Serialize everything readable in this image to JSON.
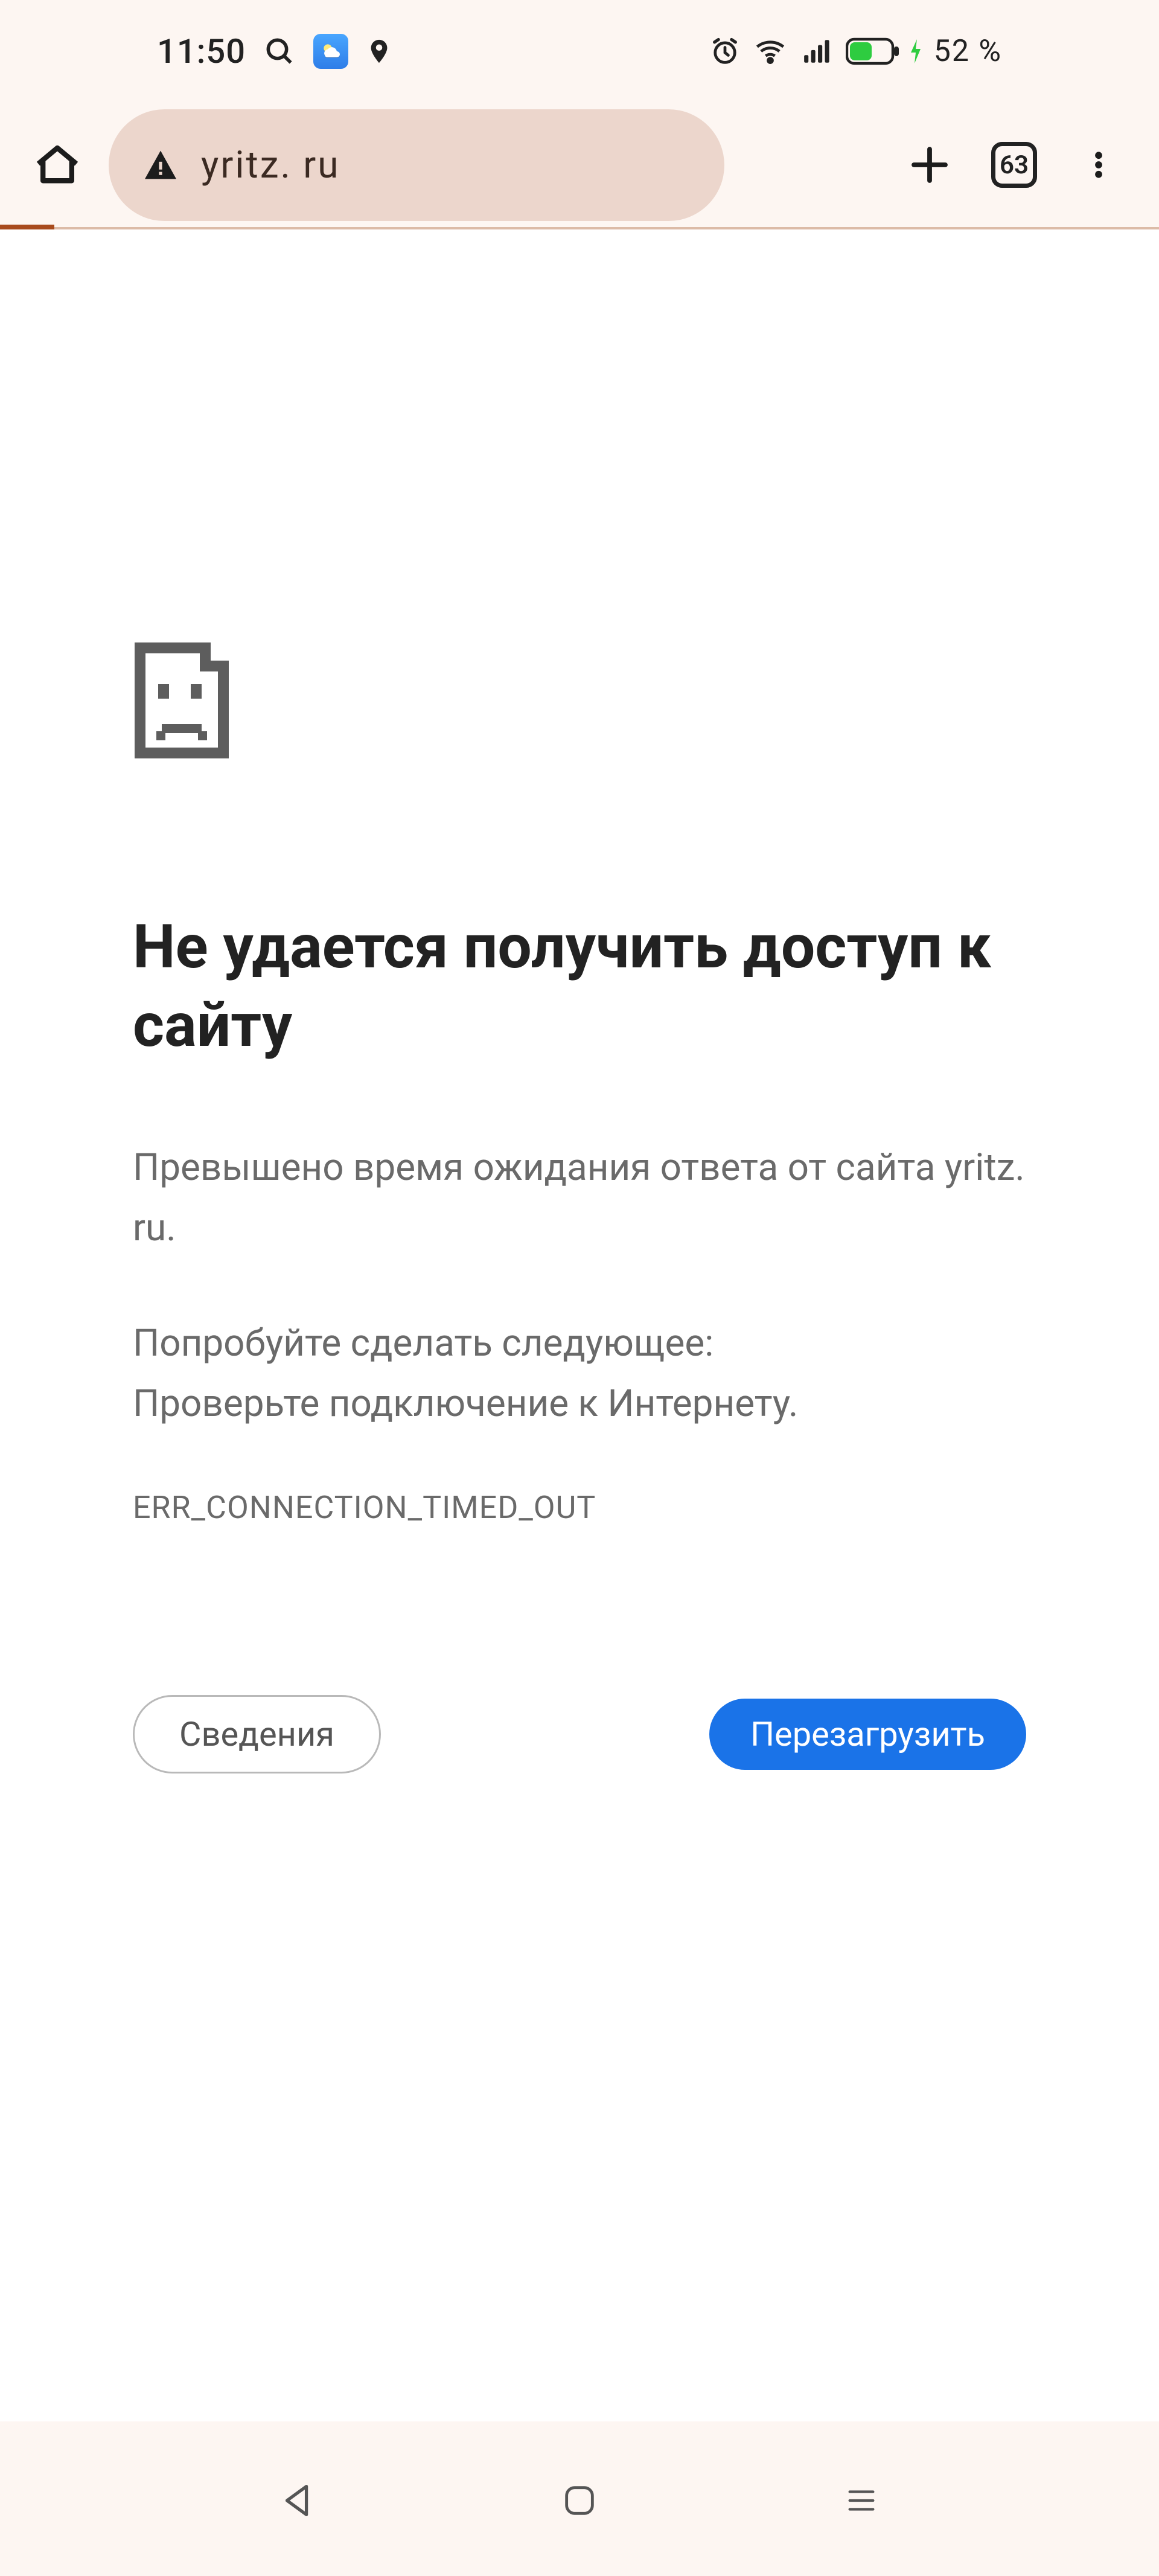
{
  "status": {
    "time": "11:50",
    "battery_text": "52 %",
    "battery_pct": 52
  },
  "browser": {
    "url": "yritz. ru",
    "tab_count": "63"
  },
  "error": {
    "title": "Не удается получить доступ к сайту",
    "msg1": "Превышено время ожидания ответа от сайта yritz. ru.",
    "msg2_line1": "Попробуйте сделать следующее:",
    "msg2_line2": "Проверьте подключение к Интернету.",
    "code": "ERR_CONNECTION_TIMED_OUT",
    "details_btn": "Сведения",
    "reload_btn": "Перезагрузить"
  }
}
